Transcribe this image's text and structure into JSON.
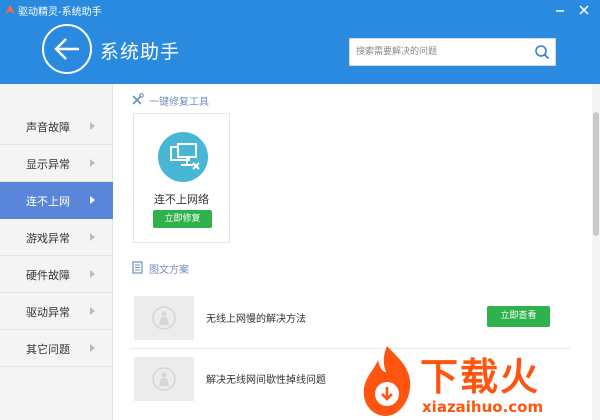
{
  "window": {
    "app_title": "驱动精灵-系统助手",
    "logo_icon": "driver-genius-logo",
    "minimize_icon": "minimize-icon",
    "close_icon": "close-icon"
  },
  "header": {
    "page_title": "系统助手",
    "back_icon": "back-arrow-icon",
    "bg_color": "#2a8ae0"
  },
  "search": {
    "placeholder": "搜索需要解决的问题",
    "icon": "search-icon"
  },
  "sidebar": {
    "items": [
      {
        "label": "声音故障",
        "active": false
      },
      {
        "label": "显示异常",
        "active": false
      },
      {
        "label": "连不上网",
        "active": true
      },
      {
        "label": "游戏异常",
        "active": false
      },
      {
        "label": "硬件故障",
        "active": false
      },
      {
        "label": "驱动异常",
        "active": false
      },
      {
        "label": "其它问题",
        "active": false
      }
    ],
    "active_color": "#5a86d9"
  },
  "main": {
    "tools_section": {
      "label": "一键修复工具",
      "icon": "tools-icon"
    },
    "tool_card": {
      "name": "连不上网络",
      "button_label": "立即修复",
      "icon": "network-disconnected-icon"
    },
    "articles_section": {
      "label": "图文方案",
      "icon": "document-icon"
    },
    "articles": [
      {
        "title": "无线上网慢的解决方法",
        "button_label": "立即查看",
        "thumb_icon": "placeholder-image-icon"
      },
      {
        "title": "解决无线网间歇性掉线问题",
        "button_label": "",
        "thumb_icon": "placeholder-image-icon"
      }
    ],
    "button_color": "#2fb14c"
  },
  "watermark": {
    "text": "下载火",
    "domain": "xiazaihuo.com",
    "color": "#ff5511"
  }
}
